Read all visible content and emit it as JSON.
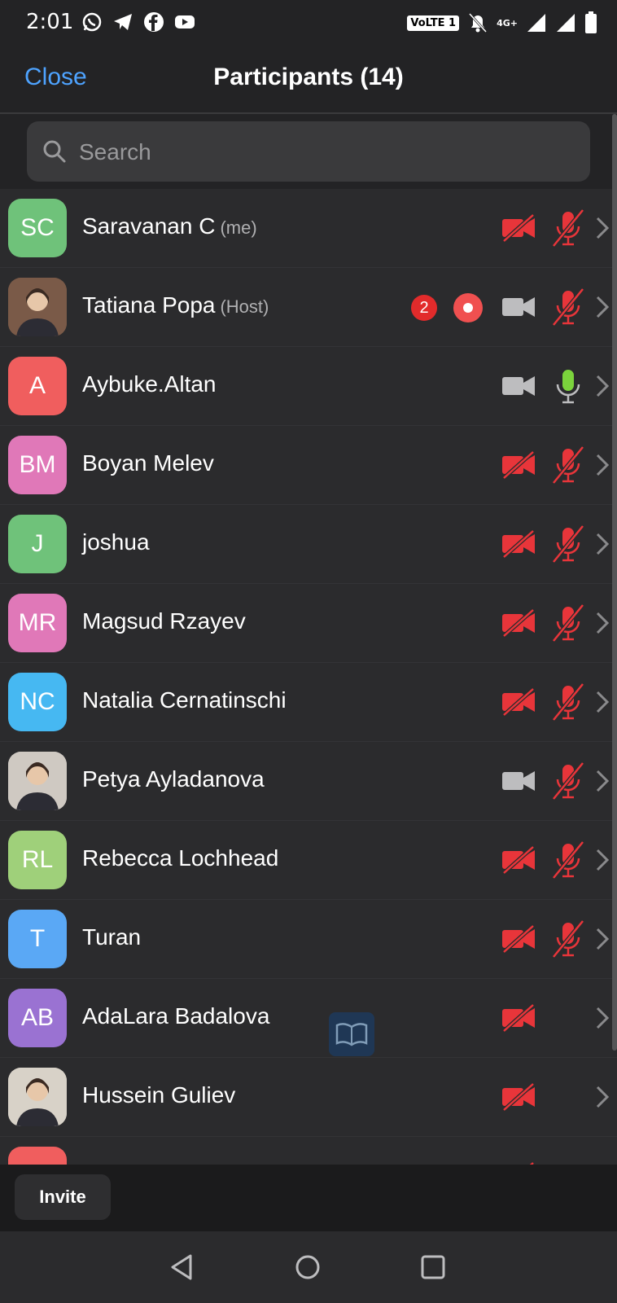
{
  "status_bar": {
    "time": "2:01",
    "apps": [
      "whatsapp-icon",
      "telegram-icon",
      "facebook-icon",
      "youtube-icon"
    ],
    "volte_label": "VoLTE 1",
    "network_label": "4G+"
  },
  "header": {
    "close_label": "Close",
    "title": "Participants (14)"
  },
  "search": {
    "placeholder": "Search"
  },
  "participants": [
    {
      "initials": "SC",
      "name": "Saravanan C",
      "tag": "(me)",
      "avatar_color": "#6fc27a",
      "video": "off",
      "mic": "muted"
    },
    {
      "initials": "",
      "name": "Tatiana Popa",
      "tag": "(Host)",
      "avatar_color": "#7a5a48",
      "photo": true,
      "badge": "2",
      "recording": true,
      "video": "on",
      "mic": "muted"
    },
    {
      "initials": "A",
      "name": "Aybuke.Altan",
      "tag": "",
      "avatar_color": "#f05e5e",
      "video": "on",
      "mic": "active"
    },
    {
      "initials": "BM",
      "name": "Boyan Melev",
      "tag": "",
      "avatar_color": "#e078b8",
      "video": "off",
      "mic": "muted"
    },
    {
      "initials": "J",
      "name": "joshua",
      "tag": "",
      "avatar_color": "#6fc27a",
      "video": "off",
      "mic": "muted"
    },
    {
      "initials": "MR",
      "name": "Magsud Rzayev",
      "tag": "",
      "avatar_color": "#e078b8",
      "video": "off",
      "mic": "muted"
    },
    {
      "initials": "NC",
      "name": "Natalia Cernatinschi",
      "tag": "",
      "avatar_color": "#46b8f2",
      "video": "off",
      "mic": "muted"
    },
    {
      "initials": "",
      "name": "Petya Ayladanova",
      "tag": "",
      "avatar_color": "#cfc9c2",
      "photo": true,
      "video": "on",
      "mic": "muted"
    },
    {
      "initials": "RL",
      "name": "Rebecca Lochhead",
      "tag": "",
      "avatar_color": "#9fd07a",
      "video": "off",
      "mic": "muted"
    },
    {
      "initials": "T",
      "name": "Turan",
      "tag": "",
      "avatar_color": "#5aa8f5",
      "video": "off",
      "mic": "muted"
    },
    {
      "initials": "AB",
      "name": "AdaLara Badalova",
      "tag": "",
      "avatar_color": "#9a72d2",
      "video": "off",
      "mic": "none"
    },
    {
      "initials": "",
      "name": "Hussein Guliev",
      "tag": "",
      "avatar_color": "#d8d2c8",
      "photo": true,
      "video": "off",
      "mic": "none"
    },
    {
      "initials": "",
      "name": "",
      "tag": "",
      "avatar_color": "#f05e5e",
      "video": "off",
      "mic": "none"
    }
  ],
  "footer": {
    "invite_label": "Invite"
  },
  "colors": {
    "accent": "#4ea3ff",
    "muted_red": "#e8353a",
    "active_green": "#7bd33c"
  }
}
